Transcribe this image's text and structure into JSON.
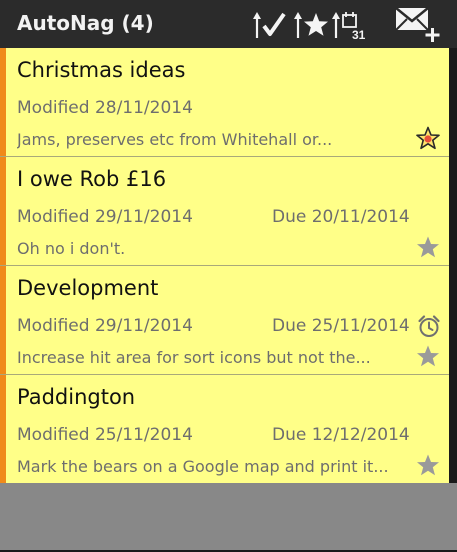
{
  "app": {
    "title": "AutoNag (4)"
  },
  "actionbar": {
    "icons": [
      {
        "name": "sort-by-completed-icon"
      },
      {
        "name": "sort-by-starred-icon"
      },
      {
        "name": "sort-by-due-icon",
        "badge": "31"
      },
      {
        "name": "add-note-icon"
      }
    ]
  },
  "colors": {
    "actionbar": "#2b2b2b",
    "note_background": "#ffff88",
    "note_stripe": "#f08a1a",
    "secondary_text": "#6e6e6e",
    "star_active_fill": "#e8503a",
    "star_inactive": "#9a9a9a",
    "empty_area": "#888888"
  },
  "notes": [
    {
      "title": "Christmas ideas",
      "modified": "Modified 28/11/2014",
      "due": "",
      "preview": "Jams, preserves etc from Whitehall or...",
      "starred": true,
      "has_alarm": false
    },
    {
      "title": "I owe Rob £16",
      "modified": "Modified 29/11/2014",
      "due": "Due 20/11/2014",
      "preview": "Oh no i don't.",
      "starred": false,
      "has_alarm": false
    },
    {
      "title": "Development",
      "modified": "Modified 29/11/2014",
      "due": "Due 25/11/2014",
      "preview": "Increase hit area for sort icons but not the...",
      "starred": false,
      "has_alarm": true
    },
    {
      "title": "Paddington",
      "modified": "Modified 25/11/2014",
      "due": "Due 12/12/2014",
      "preview": "Mark the bears on a Google map and print it...",
      "starred": false,
      "has_alarm": false
    }
  ]
}
